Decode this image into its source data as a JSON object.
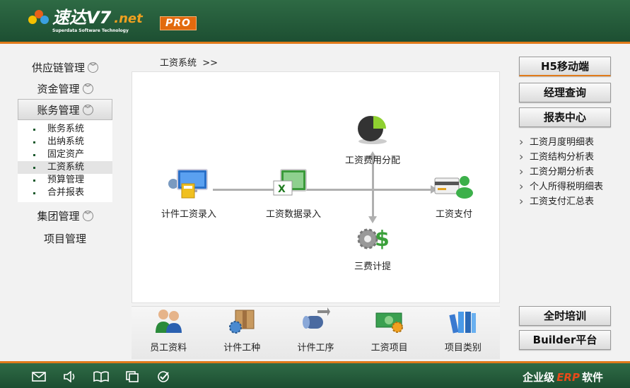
{
  "header": {
    "logo_text": "速达V7",
    "logo_net": ".net",
    "logo_sub": "Superdata Software Technology",
    "pro_badge": "PRO"
  },
  "sidebar": {
    "items": [
      {
        "label": "供应链管理"
      },
      {
        "label": "资金管理"
      },
      {
        "label": "账务管理"
      },
      {
        "label": "集团管理"
      },
      {
        "label": "项目管理"
      }
    ],
    "submenu": [
      {
        "label": "账务系统"
      },
      {
        "label": "出纳系统"
      },
      {
        "label": "固定资产"
      },
      {
        "label": "工资系统"
      },
      {
        "label": "预算管理"
      },
      {
        "label": "合并报表"
      }
    ]
  },
  "breadcrumb": "工资系统  >>",
  "flow": {
    "piecework_entry": "计件工资录入",
    "salary_data_entry": "工资数据录入",
    "expense_allocation": "工资费用分配",
    "three_fees": "三费计提",
    "salary_payment": "工资支付"
  },
  "toolbar": {
    "items": [
      {
        "label": "员工资料"
      },
      {
        "label": "计件工种"
      },
      {
        "label": "计件工序"
      },
      {
        "label": "工资项目"
      },
      {
        "label": "项目类别"
      }
    ]
  },
  "right_panel": {
    "h5_mobile": "H5移动端",
    "manager_query": "经理查询",
    "report_center": "报表中心",
    "reports": [
      {
        "label": "工资月度明细表"
      },
      {
        "label": "工资结构分析表"
      },
      {
        "label": "工资分期分析表"
      },
      {
        "label": "个人所得税明细表"
      },
      {
        "label": "工资支付汇总表"
      }
    ],
    "training": "全时培训",
    "builder": "Builder平台"
  },
  "footer": {
    "brand_prefix": "企业级",
    "brand_erp": "ERP",
    "brand_suffix": "软件"
  },
  "colors": {
    "header_green": "#1d4f32",
    "accent_orange": "#e07a1a",
    "erp_red": "#e84a1a"
  }
}
